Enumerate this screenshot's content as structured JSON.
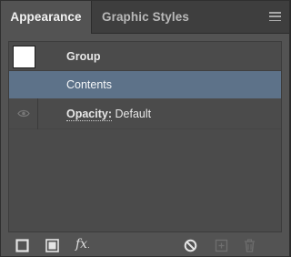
{
  "tabs": [
    {
      "label": "Appearance",
      "active": true
    },
    {
      "label": "Graphic Styles",
      "active": false
    }
  ],
  "icons": {
    "panel_menu": "hamburger-icon",
    "visibility": "eye-icon",
    "add_stroke": "square-outline-icon",
    "add_fill": "filled-square-icon",
    "add_effect": "fx-icon",
    "clear_appearance": "prohibit-icon",
    "duplicate_item": "plus-square-icon",
    "delete_item": "trash-icon"
  },
  "rows": {
    "group_label": "Group",
    "contents_label": "Contents",
    "opacity_label": "Opacity:",
    "opacity_value": "Default"
  },
  "toolbar": {
    "fx_label": "fx",
    "fx_sub": "."
  },
  "colors": {
    "selected_row": "#5d7289",
    "panel_bg": "#535353"
  }
}
